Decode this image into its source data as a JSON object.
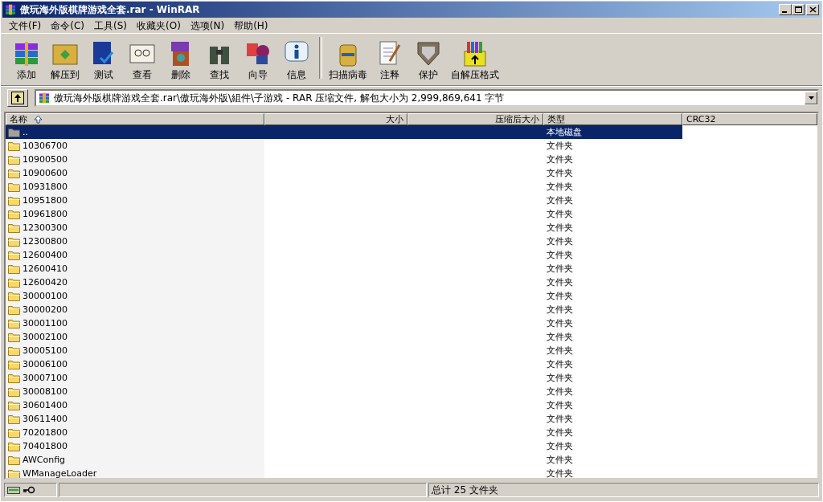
{
  "window": {
    "title": "傲玩海外版棋牌游戏全套.rar - WinRAR"
  },
  "menu": [
    "文件(F)",
    "命令(C)",
    "工具(S)",
    "收藏夹(O)",
    "选项(N)",
    "帮助(H)"
  ],
  "toolbar": [
    {
      "label": "添加"
    },
    {
      "label": "解压到"
    },
    {
      "label": "测试"
    },
    {
      "label": "查看"
    },
    {
      "label": "删除"
    },
    {
      "label": "查找"
    },
    {
      "label": "向导"
    },
    {
      "label": "信息"
    },
    {
      "label": "扫描病毒"
    },
    {
      "label": "注释"
    },
    {
      "label": "保护"
    },
    {
      "label": "自解压格式"
    }
  ],
  "address": {
    "value": "傲玩海外版棋牌游戏全套.rar\\傲玩海外版\\組件\\子游戏 - RAR 压缩文件, 解包大小为 2,999,869,641 字节"
  },
  "table": {
    "columns": [
      "名称",
      "大小",
      "压缩后大小",
      "类型",
      "CRC32"
    ],
    "rows": [
      {
        "kind": "parent",
        "name": "..",
        "type": "本地磁盘",
        "selected": true
      },
      {
        "kind": "folder",
        "name": "10306700",
        "type": "文件夹",
        "selected": false
      },
      {
        "kind": "folder",
        "name": "10900500",
        "type": "文件夹",
        "selected": false
      },
      {
        "kind": "folder",
        "name": "10900600",
        "type": "文件夹",
        "selected": false
      },
      {
        "kind": "folder",
        "name": "10931800",
        "type": "文件夹",
        "selected": false
      },
      {
        "kind": "folder",
        "name": "10951800",
        "type": "文件夹",
        "selected": false
      },
      {
        "kind": "folder",
        "name": "10961800",
        "type": "文件夹",
        "selected": false
      },
      {
        "kind": "folder",
        "name": "12300300",
        "type": "文件夹",
        "selected": false
      },
      {
        "kind": "folder",
        "name": "12300800",
        "type": "文件夹",
        "selected": false
      },
      {
        "kind": "folder",
        "name": "12600400",
        "type": "文件夹",
        "selected": false
      },
      {
        "kind": "folder",
        "name": "12600410",
        "type": "文件夹",
        "selected": false
      },
      {
        "kind": "folder",
        "name": "12600420",
        "type": "文件夹",
        "selected": false
      },
      {
        "kind": "folder",
        "name": "30000100",
        "type": "文件夹",
        "selected": false
      },
      {
        "kind": "folder",
        "name": "30000200",
        "type": "文件夹",
        "selected": false
      },
      {
        "kind": "folder",
        "name": "30001100",
        "type": "文件夹",
        "selected": false
      },
      {
        "kind": "folder",
        "name": "30002100",
        "type": "文件夹",
        "selected": false
      },
      {
        "kind": "folder",
        "name": "30005100",
        "type": "文件夹",
        "selected": false
      },
      {
        "kind": "folder",
        "name": "30006100",
        "type": "文件夹",
        "selected": false
      },
      {
        "kind": "folder",
        "name": "30007100",
        "type": "文件夹",
        "selected": false
      },
      {
        "kind": "folder",
        "name": "30008100",
        "type": "文件夹",
        "selected": false
      },
      {
        "kind": "folder",
        "name": "30601400",
        "type": "文件夹",
        "selected": false
      },
      {
        "kind": "folder",
        "name": "30611400",
        "type": "文件夹",
        "selected": false
      },
      {
        "kind": "folder",
        "name": "70201800",
        "type": "文件夹",
        "selected": false
      },
      {
        "kind": "folder",
        "name": "70401800",
        "type": "文件夹",
        "selected": false
      },
      {
        "kind": "folder",
        "name": "AWConfig",
        "type": "文件夹",
        "selected": false
      },
      {
        "kind": "folder",
        "name": "WManageLoader",
        "type": "文件夹",
        "selected": false
      }
    ]
  },
  "status_bar": {
    "total": "总计 25 文件夹"
  }
}
